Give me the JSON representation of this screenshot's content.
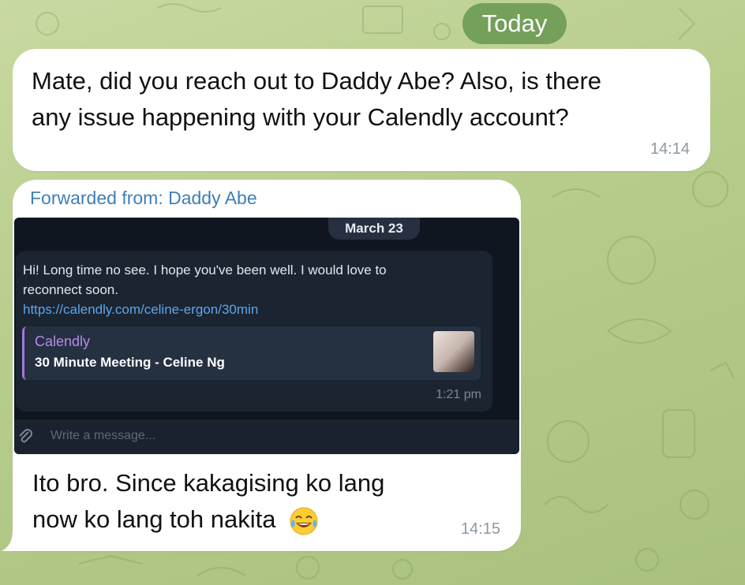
{
  "background": {
    "accent": "#b6cc8a"
  },
  "date_separator": {
    "label": "Today",
    "color": "#74a05a"
  },
  "messages": [
    {
      "text_line1": "Mate, did you reach out to Daddy Abe? Also, is there",
      "text_line2": "any issue happening with your Calendly account?",
      "time": "14:14"
    },
    {
      "forwarded_prefix": "Forwarded from: ",
      "forwarded_name": "Daddy Abe",
      "screenshot": {
        "date_label": "March 23",
        "text_line1": "Hi! Long time no see. I hope you've been well. I would love to",
        "text_line2": "reconnect soon.",
        "link": "https://calendly.com/celine-ergon/30min",
        "card_title": "Calendly",
        "card_subtitle": "30 Minute Meeting - Celine Ng",
        "time": "1:21 pm",
        "composer_placeholder": "Write a message..."
      },
      "reply_line1": "Ito bro. Since kakagising ko lang",
      "reply_line2": "now ko lang toh nakita",
      "reply_emoji": "tears-of-joy-emoji",
      "time": "14:15"
    }
  ]
}
